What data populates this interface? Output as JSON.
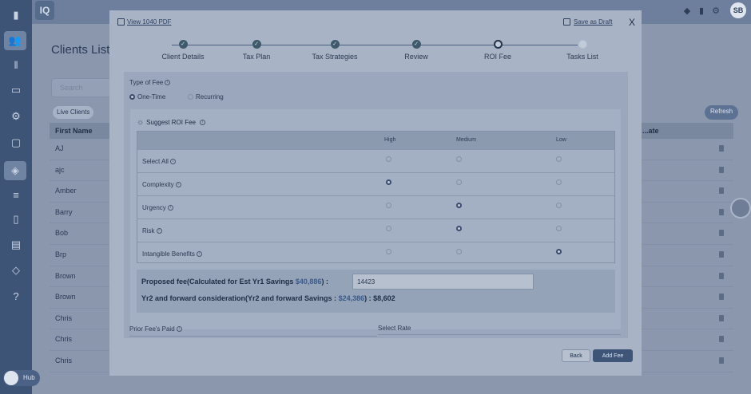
{
  "app": {
    "logo_text": "IQ",
    "user_initials": "SB",
    "hub_label": "Hub"
  },
  "background": {
    "page_title": "Clients List",
    "search_placeholder": "Search",
    "live_clients_label": "Live Clients",
    "refresh_label": "Refresh",
    "columns": [
      "First Name",
      "...ate"
    ],
    "rows": [
      "AJ",
      "ajc",
      "Amber",
      "Barry",
      "Bob",
      "Brp",
      "Brown",
      "Brown",
      "Chris",
      "Chris",
      "Chris"
    ]
  },
  "modal": {
    "view_pdf": "View 1040 PDF",
    "save_draft": "Save as Draft",
    "close": "X",
    "steps": [
      {
        "label": "Client Details",
        "status": "done"
      },
      {
        "label": "Tax Plan",
        "status": "done"
      },
      {
        "label": "Tax Strategies",
        "status": "done"
      },
      {
        "label": "Review",
        "status": "done"
      },
      {
        "label": "ROI Fee",
        "status": "current"
      },
      {
        "label": "Tasks List",
        "status": "todo"
      }
    ],
    "type_of_fee": {
      "label": "Type of Fee",
      "options": [
        {
          "label": "One-Time",
          "selected": true
        },
        {
          "label": "Recurring",
          "selected": false
        }
      ]
    },
    "suggest_title": "Suggest ROI Fee",
    "table": {
      "headers": [
        "High",
        "Medium",
        "Low"
      ],
      "rows": [
        {
          "label": "Select All",
          "selected": null
        },
        {
          "label": "Complexity",
          "selected": "High"
        },
        {
          "label": "Urgency",
          "selected": "Medium"
        },
        {
          "label": "Risk",
          "selected": "Medium"
        },
        {
          "label": "Intangible Benefits",
          "selected": "Low"
        }
      ]
    },
    "proposed_prefix": "Proposed fee(Calculated for Est Yr1 Savings ",
    "proposed_amount": "$40,886",
    "proposed_suffix": ") :",
    "fee_value": "14423",
    "yr2_prefix": "Yr2 and forward consideration(Yr2 and forward Savings : ",
    "yr2_savings": "$24,386",
    "yr2_mid": ") : ",
    "yr2_fee": "$8,602",
    "prior_fee_label": "Prior Fee's Paid",
    "select_rate_label": "Select Rate",
    "back_label": "Back",
    "add_fee_label": "Add Fee"
  },
  "colors": {
    "accent": "#3f5578",
    "done_step": "#3e5a6c",
    "highlight": "#3a5a8a"
  }
}
